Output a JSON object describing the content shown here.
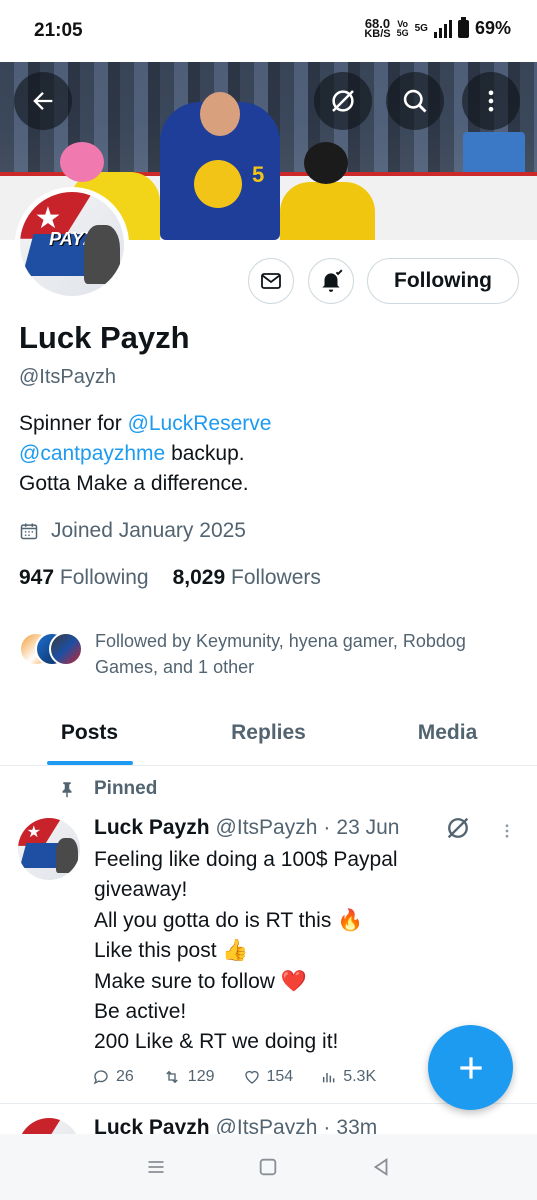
{
  "status_bar": {
    "time": "21:05",
    "net_speed": "68.0",
    "net_unit": "KB/S",
    "volte_top": "Vo",
    "volte_bottom": "5G",
    "network": "5G",
    "battery": "69%"
  },
  "header": {
    "back_icon": "arrow-left-icon",
    "grok_icon": "grok-icon",
    "search_icon": "search-icon",
    "more_icon": "more-vertical-icon"
  },
  "profile": {
    "name": "Luck Payzh",
    "handle": "@ItsPayzh",
    "avatar_text": "PAYZH",
    "bio_line1_prefix": "Spinner for ",
    "bio_line1_link": "@LuckReserve",
    "bio_line2_link": "@cantpayzhme",
    "bio_line2_suffix": " backup.",
    "bio_line3": "Gotta Make a difference.",
    "joined": "Joined January 2025",
    "following_count": "947",
    "following_label": "Following",
    "followers_count": "8,029",
    "followers_label": "Followers",
    "followed_by": "Followed by Keymunity, hyena gamer, Robdog Games, and 1 other"
  },
  "actions": {
    "message_icon": "envelope-icon",
    "notify_icon": "bell-check-icon",
    "following_button": "Following"
  },
  "tabs": [
    {
      "label": "Posts",
      "active": true
    },
    {
      "label": "Replies",
      "active": false
    },
    {
      "label": "Media",
      "active": false
    }
  ],
  "pinned_post": {
    "pinned_label": "Pinned",
    "author": "Luck Payzh",
    "handle": "@ItsPayzh",
    "dot": "·",
    "time": "23 Jun",
    "lines": [
      "Feeling like doing a 100$ Paypal giveaway!",
      "All you gotta do is RT this 🔥",
      "Like this post 👍",
      "Make sure to follow ❤️",
      "Be active!",
      "200 Like & RT we doing it!"
    ],
    "replies": "26",
    "reposts": "129",
    "likes": "154",
    "views": "5.3K"
  },
  "next_post": {
    "author": "Luck Payzh",
    "handle": "@ItsPayzh",
    "dot": "·",
    "time": "33m"
  },
  "fab": {
    "icon": "plus-icon"
  },
  "colors": {
    "accent": "#1d9bf0",
    "text_primary": "#0f1419",
    "text_secondary": "#536471",
    "border": "#cfd9de"
  }
}
